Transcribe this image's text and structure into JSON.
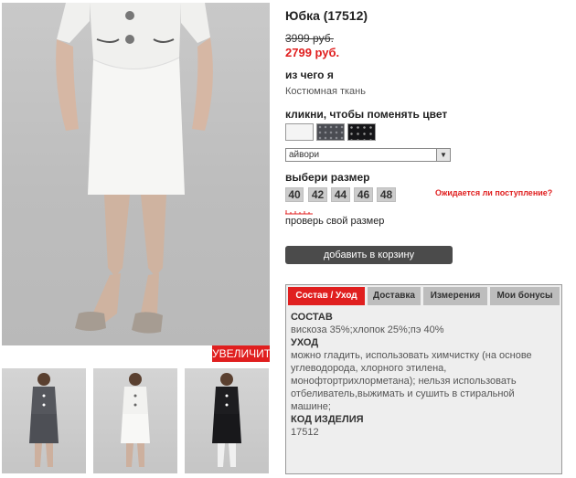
{
  "product": {
    "title": "Юбка (17512)",
    "old_price": "3999 руб.",
    "new_price": "2799 руб."
  },
  "material": {
    "label": "из чего я",
    "value": "Костюмная ткань"
  },
  "colors": {
    "label": "кликни, чтобы поменять цвет",
    "swatches": [
      "ivory",
      "dark-grey-dotted",
      "black-dotted"
    ],
    "selected": "айвори"
  },
  "sizes": {
    "label": "выбери размер",
    "options": [
      "40",
      "42",
      "44",
      "46",
      "48"
    ],
    "awaiting_link": "Ожидается ли поступление?",
    "check_size_link": "проверь свой размер"
  },
  "actions": {
    "add_to_cart": "добавить в корзину",
    "zoom": "УВЕЛИЧИТЬ"
  },
  "tabs": {
    "items": [
      "Состав / Уход",
      "Доставка",
      "Измерения",
      "Мои бонусы"
    ],
    "active": "Состав / Уход"
  },
  "details": {
    "composition_head": "СОСТАВ",
    "composition": "вискоза 35%;хлопок 25%;пэ 40%",
    "care_head": "УХОД",
    "care": "можно гладить, использовать химчистку (на основе углеводорода, хлорного этилена, монофтортрихлорметана); нельзя использовать отбеливатель,выжимать и сушить в стиральной машине;",
    "code_head": "КОД ИЗДЕЛИЯ",
    "code": "17512"
  },
  "colors_hex": {
    "accent": "#e01f1f",
    "button_dark": "#4b4b4b",
    "tab_inactive": "#bdbdbd",
    "panel_bg": "#eeeeee"
  }
}
